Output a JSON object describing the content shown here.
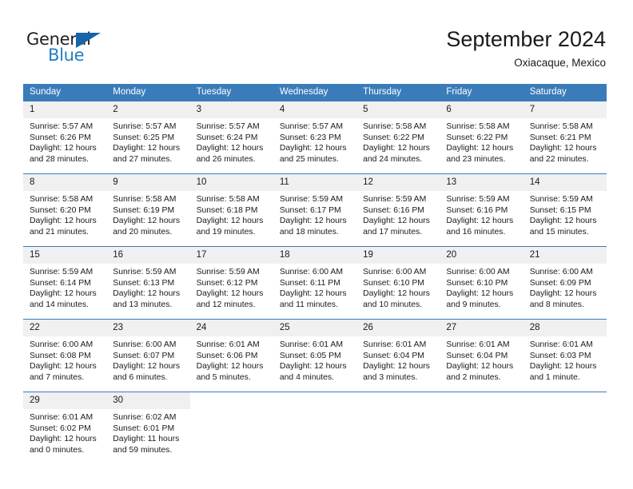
{
  "brand": {
    "name_part1": "General",
    "name_part2": "Blue",
    "color_dark": "#231f20",
    "color_blue": "#1f7fc4"
  },
  "header": {
    "title": "September 2024",
    "subtitle": "Oxiacaque, Mexico"
  },
  "theme": {
    "header_bg": "#3a7cba",
    "daynum_bg": "#f0f0f0",
    "grid_line": "#3a7cba",
    "text": "#1a1a1a"
  },
  "weekdays": [
    "Sunday",
    "Monday",
    "Tuesday",
    "Wednesday",
    "Thursday",
    "Friday",
    "Saturday"
  ],
  "weeks": [
    [
      {
        "day": "1",
        "sunrise": "Sunrise: 5:57 AM",
        "sunset": "Sunset: 6:26 PM",
        "daylight_1": "Daylight: 12 hours",
        "daylight_2": "and 28 minutes."
      },
      {
        "day": "2",
        "sunrise": "Sunrise: 5:57 AM",
        "sunset": "Sunset: 6:25 PM",
        "daylight_1": "Daylight: 12 hours",
        "daylight_2": "and 27 minutes."
      },
      {
        "day": "3",
        "sunrise": "Sunrise: 5:57 AM",
        "sunset": "Sunset: 6:24 PM",
        "daylight_1": "Daylight: 12 hours",
        "daylight_2": "and 26 minutes."
      },
      {
        "day": "4",
        "sunrise": "Sunrise: 5:57 AM",
        "sunset": "Sunset: 6:23 PM",
        "daylight_1": "Daylight: 12 hours",
        "daylight_2": "and 25 minutes."
      },
      {
        "day": "5",
        "sunrise": "Sunrise: 5:58 AM",
        "sunset": "Sunset: 6:22 PM",
        "daylight_1": "Daylight: 12 hours",
        "daylight_2": "and 24 minutes."
      },
      {
        "day": "6",
        "sunrise": "Sunrise: 5:58 AM",
        "sunset": "Sunset: 6:22 PM",
        "daylight_1": "Daylight: 12 hours",
        "daylight_2": "and 23 minutes."
      },
      {
        "day": "7",
        "sunrise": "Sunrise: 5:58 AM",
        "sunset": "Sunset: 6:21 PM",
        "daylight_1": "Daylight: 12 hours",
        "daylight_2": "and 22 minutes."
      }
    ],
    [
      {
        "day": "8",
        "sunrise": "Sunrise: 5:58 AM",
        "sunset": "Sunset: 6:20 PM",
        "daylight_1": "Daylight: 12 hours",
        "daylight_2": "and 21 minutes."
      },
      {
        "day": "9",
        "sunrise": "Sunrise: 5:58 AM",
        "sunset": "Sunset: 6:19 PM",
        "daylight_1": "Daylight: 12 hours",
        "daylight_2": "and 20 minutes."
      },
      {
        "day": "10",
        "sunrise": "Sunrise: 5:58 AM",
        "sunset": "Sunset: 6:18 PM",
        "daylight_1": "Daylight: 12 hours",
        "daylight_2": "and 19 minutes."
      },
      {
        "day": "11",
        "sunrise": "Sunrise: 5:59 AM",
        "sunset": "Sunset: 6:17 PM",
        "daylight_1": "Daylight: 12 hours",
        "daylight_2": "and 18 minutes."
      },
      {
        "day": "12",
        "sunrise": "Sunrise: 5:59 AM",
        "sunset": "Sunset: 6:16 PM",
        "daylight_1": "Daylight: 12 hours",
        "daylight_2": "and 17 minutes."
      },
      {
        "day": "13",
        "sunrise": "Sunrise: 5:59 AM",
        "sunset": "Sunset: 6:16 PM",
        "daylight_1": "Daylight: 12 hours",
        "daylight_2": "and 16 minutes."
      },
      {
        "day": "14",
        "sunrise": "Sunrise: 5:59 AM",
        "sunset": "Sunset: 6:15 PM",
        "daylight_1": "Daylight: 12 hours",
        "daylight_2": "and 15 minutes."
      }
    ],
    [
      {
        "day": "15",
        "sunrise": "Sunrise: 5:59 AM",
        "sunset": "Sunset: 6:14 PM",
        "daylight_1": "Daylight: 12 hours",
        "daylight_2": "and 14 minutes."
      },
      {
        "day": "16",
        "sunrise": "Sunrise: 5:59 AM",
        "sunset": "Sunset: 6:13 PM",
        "daylight_1": "Daylight: 12 hours",
        "daylight_2": "and 13 minutes."
      },
      {
        "day": "17",
        "sunrise": "Sunrise: 5:59 AM",
        "sunset": "Sunset: 6:12 PM",
        "daylight_1": "Daylight: 12 hours",
        "daylight_2": "and 12 minutes."
      },
      {
        "day": "18",
        "sunrise": "Sunrise: 6:00 AM",
        "sunset": "Sunset: 6:11 PM",
        "daylight_1": "Daylight: 12 hours",
        "daylight_2": "and 11 minutes."
      },
      {
        "day": "19",
        "sunrise": "Sunrise: 6:00 AM",
        "sunset": "Sunset: 6:10 PM",
        "daylight_1": "Daylight: 12 hours",
        "daylight_2": "and 10 minutes."
      },
      {
        "day": "20",
        "sunrise": "Sunrise: 6:00 AM",
        "sunset": "Sunset: 6:10 PM",
        "daylight_1": "Daylight: 12 hours",
        "daylight_2": "and 9 minutes."
      },
      {
        "day": "21",
        "sunrise": "Sunrise: 6:00 AM",
        "sunset": "Sunset: 6:09 PM",
        "daylight_1": "Daylight: 12 hours",
        "daylight_2": "and 8 minutes."
      }
    ],
    [
      {
        "day": "22",
        "sunrise": "Sunrise: 6:00 AM",
        "sunset": "Sunset: 6:08 PM",
        "daylight_1": "Daylight: 12 hours",
        "daylight_2": "and 7 minutes."
      },
      {
        "day": "23",
        "sunrise": "Sunrise: 6:00 AM",
        "sunset": "Sunset: 6:07 PM",
        "daylight_1": "Daylight: 12 hours",
        "daylight_2": "and 6 minutes."
      },
      {
        "day": "24",
        "sunrise": "Sunrise: 6:01 AM",
        "sunset": "Sunset: 6:06 PM",
        "daylight_1": "Daylight: 12 hours",
        "daylight_2": "and 5 minutes."
      },
      {
        "day": "25",
        "sunrise": "Sunrise: 6:01 AM",
        "sunset": "Sunset: 6:05 PM",
        "daylight_1": "Daylight: 12 hours",
        "daylight_2": "and 4 minutes."
      },
      {
        "day": "26",
        "sunrise": "Sunrise: 6:01 AM",
        "sunset": "Sunset: 6:04 PM",
        "daylight_1": "Daylight: 12 hours",
        "daylight_2": "and 3 minutes."
      },
      {
        "day": "27",
        "sunrise": "Sunrise: 6:01 AM",
        "sunset": "Sunset: 6:04 PM",
        "daylight_1": "Daylight: 12 hours",
        "daylight_2": "and 2 minutes."
      },
      {
        "day": "28",
        "sunrise": "Sunrise: 6:01 AM",
        "sunset": "Sunset: 6:03 PM",
        "daylight_1": "Daylight: 12 hours",
        "daylight_2": "and 1 minute."
      }
    ],
    [
      {
        "day": "29",
        "sunrise": "Sunrise: 6:01 AM",
        "sunset": "Sunset: 6:02 PM",
        "daylight_1": "Daylight: 12 hours",
        "daylight_2": "and 0 minutes."
      },
      {
        "day": "30",
        "sunrise": "Sunrise: 6:02 AM",
        "sunset": "Sunset: 6:01 PM",
        "daylight_1": "Daylight: 11 hours",
        "daylight_2": "and 59 minutes."
      },
      {
        "day": "",
        "sunrise": "",
        "sunset": "",
        "daylight_1": "",
        "daylight_2": ""
      },
      {
        "day": "",
        "sunrise": "",
        "sunset": "",
        "daylight_1": "",
        "daylight_2": ""
      },
      {
        "day": "",
        "sunrise": "",
        "sunset": "",
        "daylight_1": "",
        "daylight_2": ""
      },
      {
        "day": "",
        "sunrise": "",
        "sunset": "",
        "daylight_1": "",
        "daylight_2": ""
      },
      {
        "day": "",
        "sunrise": "",
        "sunset": "",
        "daylight_1": "",
        "daylight_2": ""
      }
    ]
  ]
}
